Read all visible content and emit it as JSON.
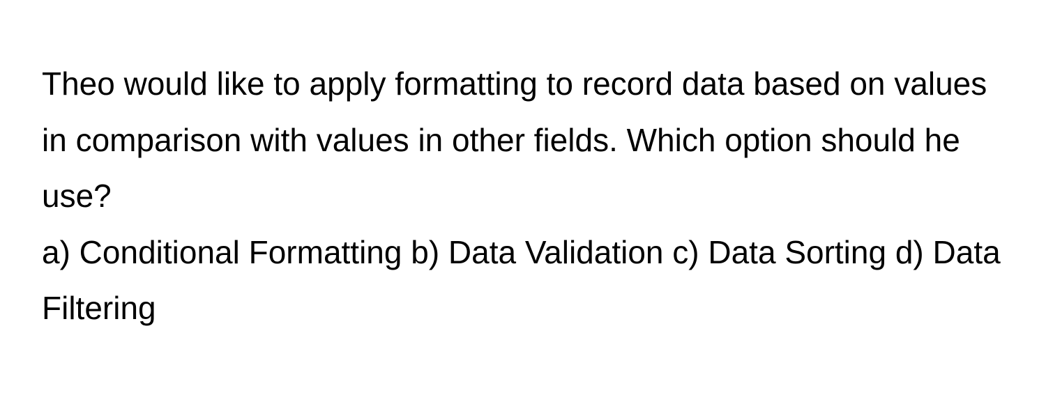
{
  "question": {
    "prompt": "Theo would like to apply formatting to record data based on values in comparison with values in other fields. Which option should he use?",
    "options_line": "a) Conditional Formatting b) Data Validation c) Data Sorting d) Data Filtering"
  }
}
